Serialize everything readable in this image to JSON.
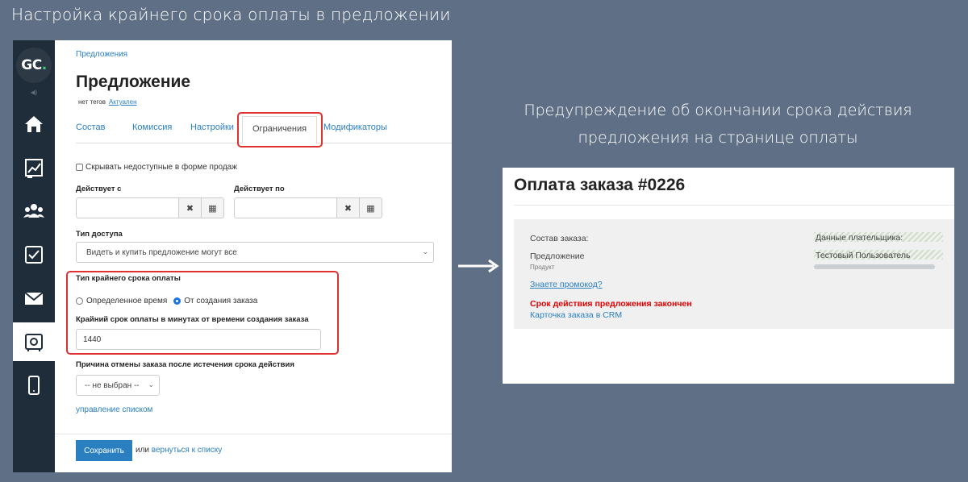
{
  "heading": "Настройка крайнего срока оплаты в предложении",
  "caption": {
    "line1": "Предупреждение об окончании срока действия",
    "line2": "предложения на странице оплаты"
  },
  "app": {
    "logo": {
      "letters": "GC",
      "dot": "."
    },
    "sidebar": [
      {
        "name": "home-icon"
      },
      {
        "name": "chart-icon"
      },
      {
        "name": "users-icon"
      },
      {
        "name": "checklist-icon"
      },
      {
        "name": "mail-icon"
      },
      {
        "name": "safe-icon",
        "active": true
      },
      {
        "name": "mobile-icon"
      }
    ],
    "breadcrumb": "Предложения",
    "title": "Предложение",
    "tags_text": "нет тегов",
    "status": "Актуален",
    "tabs": [
      "Состав",
      "Комиссия",
      "Настройки",
      "Ограничения",
      "Модификаторы"
    ],
    "active_tab": "Ограничения",
    "hide_unavailable": "Скрывать недоступные в форме продаж",
    "valid_from_label": "Действует с",
    "valid_to_label": "Действует по",
    "clear_symbol": "✖",
    "calendar_symbol": "▦",
    "access_label": "Тип доступа",
    "access_value": "Видеть и купить предложение могут все",
    "deadline_type_label": "Тип крайнего срока оплаты",
    "radio_fixed": "Определенное время",
    "radio_from_order": "От создания заказа",
    "deadline_minutes_label": "Крайний срок оплаты в минутах от времени создания заказа",
    "deadline_minutes_value": "1440",
    "cancel_reason_label": "Причина отмены заказа после истечения срока действия",
    "cancel_reason_value": "-- не выбран --",
    "manage_list_link": "управление списком",
    "save_button": "Сохранить",
    "or_text": "или",
    "back_link": "вернуться к списку"
  },
  "payment": {
    "title": "Оплата заказа #0226",
    "order_contents_label": "Состав заказа:",
    "item_name": "Предложение",
    "item_type": "Продукт",
    "promo_link": "Знаете промокод?",
    "expired_warning": "Срок действия предложения закончен",
    "crm_link": "Карточка заказа в CRM",
    "payer_label": "Данные плательщика:",
    "payer_name": "Тестовый Пользователь"
  },
  "colors": {
    "background": "#5f7086",
    "sidebar": "#1f2d3a",
    "link": "#2a7fc0",
    "highlight_box": "#e03131",
    "warning": "#e00000",
    "accent_green": "#3cd07a"
  }
}
